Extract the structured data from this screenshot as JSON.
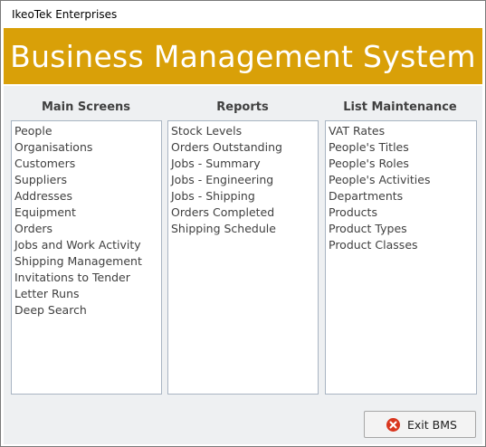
{
  "window": {
    "title": "IkeoTek Enterprises"
  },
  "banner": {
    "title": "Business Management System",
    "color": "#d9a008"
  },
  "columns": [
    {
      "header": "Main Screens",
      "items": [
        "People",
        "Organisations",
        "Customers",
        "Suppliers",
        "Addresses",
        "Equipment",
        "Orders",
        "Jobs and Work Activity",
        "Shipping Management",
        "Invitations to Tender",
        "Letter Runs",
        "Deep Search"
      ]
    },
    {
      "header": "Reports",
      "items": [
        "Stock Levels",
        "Orders Outstanding",
        "Jobs - Summary",
        "Jobs - Engineering",
        "Jobs - Shipping",
        "Orders Completed",
        "Shipping Schedule"
      ]
    },
    {
      "header": "List Maintenance",
      "items": [
        "VAT Rates",
        "People's Titles",
        "People's Roles",
        "People's Activities",
        "Departments",
        "Products",
        "Product Types",
        "Product Classes"
      ]
    }
  ],
  "exit_button": {
    "label": "Exit BMS",
    "icon": "close-circle-icon",
    "icon_color": "#d9361e"
  }
}
